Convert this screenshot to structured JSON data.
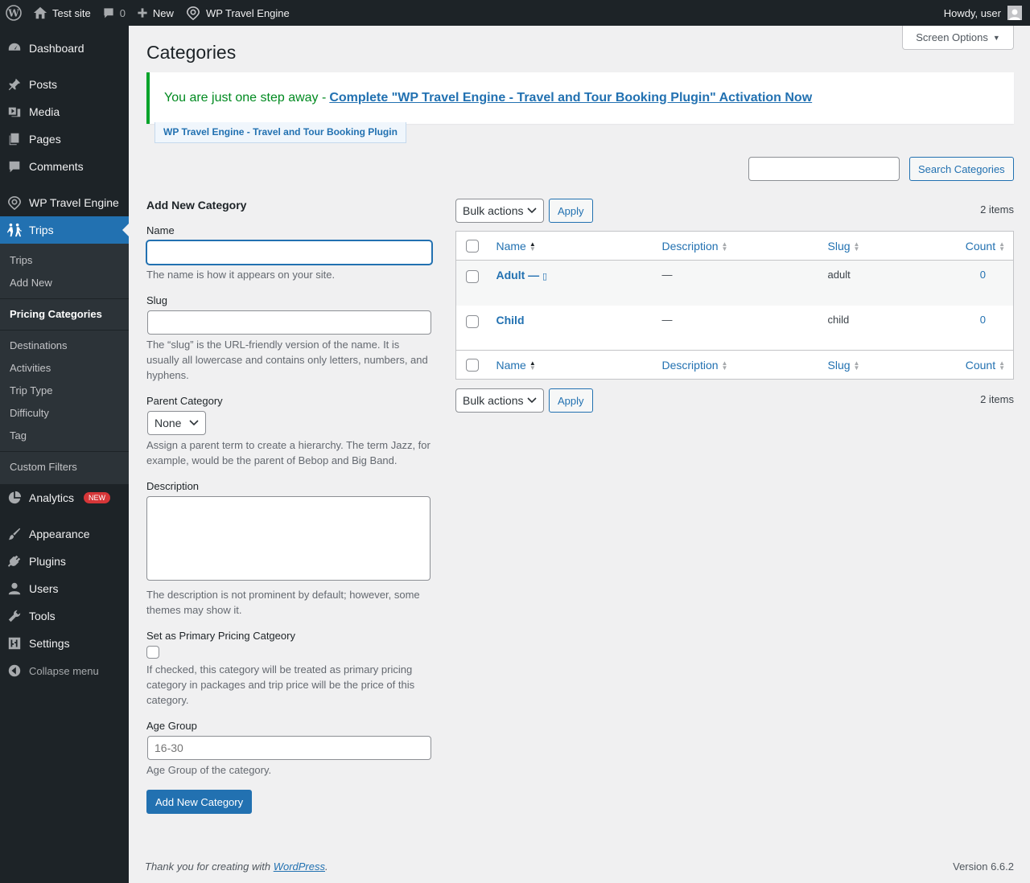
{
  "adminbar": {
    "site_name": "Test site",
    "comments_count": "0",
    "new_label": "New",
    "plugin_label": "WP Travel Engine",
    "howdy": "Howdy, user"
  },
  "sidebar": {
    "dashboard": "Dashboard",
    "posts": "Posts",
    "media": "Media",
    "pages": "Pages",
    "comments": "Comments",
    "wp_travel_engine": "WP Travel Engine",
    "trips": "Trips",
    "submenu": {
      "trips": "Trips",
      "add_new": "Add New",
      "pricing_categories": "Pricing Categories",
      "destinations": "Destinations",
      "activities": "Activities",
      "trip_type": "Trip Type",
      "difficulty": "Difficulty",
      "tag": "Tag",
      "custom_filters": "Custom Filters"
    },
    "analytics": "Analytics",
    "analytics_badge": "NEW",
    "appearance": "Appearance",
    "plugins": "Plugins",
    "users": "Users",
    "tools": "Tools",
    "settings": "Settings",
    "collapse": "Collapse menu"
  },
  "header": {
    "title": "Categories",
    "screen_options": "Screen Options"
  },
  "notice": {
    "text": "You are just one step away -",
    "link": "Complete \"WP Travel Engine - Travel and Tour Booking Plugin\" Activation Now",
    "tab": "WP Travel Engine - Travel and Tour Booking Plugin"
  },
  "search": {
    "value": "",
    "button": "Search Categories"
  },
  "form": {
    "title": "Add New Category",
    "name_label": "Name",
    "name_value": "",
    "name_help": "The name is how it appears on your site.",
    "slug_label": "Slug",
    "slug_value": "",
    "slug_help": "The “slug” is the URL-friendly version of the name. It is usually all lowercase and contains only letters, numbers, and hyphens.",
    "parent_label": "Parent Category",
    "parent_value": "None",
    "parent_help": "Assign a parent term to create a hierarchy. The term Jazz, for example, would be the parent of Bebop and Big Band.",
    "description_label": "Description",
    "description_help": "The description is not prominent by default; however, some themes may show it.",
    "primary_label": "Set as Primary Pricing Catgeory",
    "primary_help": "If checked, this category will be treated as primary pricing category in packages and trip price will be the price of this category.",
    "age_label": "Age Group",
    "age_placeholder": "16-30",
    "age_help": "Age Group of the category.",
    "submit": "Add New Category"
  },
  "table": {
    "bulk_actions": "Bulk actions",
    "apply": "Apply",
    "items_count": "2 items",
    "columns": {
      "name": "Name",
      "description": "Description",
      "slug": "Slug",
      "count": "Count"
    },
    "rows": [
      {
        "name": "Adult — ",
        "description": "—",
        "slug": "adult",
        "count": "0"
      },
      {
        "name": "Child",
        "description": "—",
        "slug": "child",
        "count": "0"
      }
    ]
  },
  "footer": {
    "thanks_prefix": "Thank you for creating with",
    "wordpress": "WordPress",
    "period": ".",
    "version": "Version 6.6.2"
  },
  "colors": {
    "sidebar_bg": "#1d2327",
    "accent": "#2271b1",
    "notice_green": "#00a32a"
  }
}
